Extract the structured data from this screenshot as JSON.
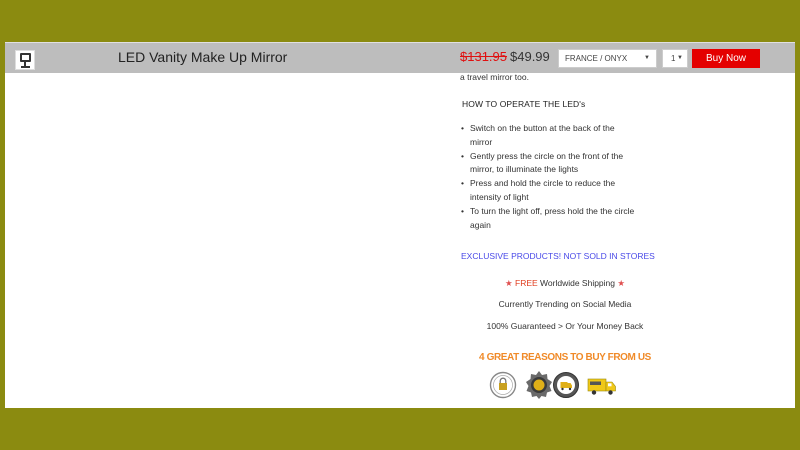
{
  "header": {
    "product_title": "LED Vanity Make Up Mirror",
    "price_old": "$131.95",
    "price_new": "$49.99",
    "variant_select": "FRANCE / ONYX",
    "quantity_select": "1",
    "buy_button": "Buy Now"
  },
  "description": {
    "travel_line": "a travel mirror too.",
    "howto_heading": "HOW TO OPERATE THE LED's",
    "bullets": [
      {
        "line1": "Switch on the button at the back of the",
        "line2": "mirror"
      },
      {
        "line1": "Gently press the circle on the front of the",
        "line2": "mirror, to illuminate the lights"
      },
      {
        "line1": "Press and hold the circle to reduce the",
        "line2": "intensity of light"
      },
      {
        "line1": "To turn the light off, press hold the the circle",
        "line2": "again"
      }
    ],
    "exclusive": "EXCLUSIVE PRODUCTS! NOT SOLD IN STORES",
    "shipping_star": "★",
    "shipping_free": "FREE",
    "shipping_rest": " Worldwide Shipping ",
    "trending": "Currently Trending on Social Media",
    "guarantee": "100% Guaranteed > Or Your Money Back"
  },
  "trust": {
    "heading": "4 GREAT REASONS TO BUY FROM US",
    "badges": [
      "secure-checkout-badge-icon",
      "100-percent-guarantee-badge-icon",
      "worldwide-shipping-badge-icon",
      "free-delivery-truck-icon"
    ]
  },
  "colors": {
    "outer_background": "#8b8b10",
    "header_bar": "#bdbdbd",
    "buy_button": "#e40000",
    "old_price": "#e01010",
    "exclusive_text": "#4a4ae8",
    "reasons_heading": "#f08a28"
  }
}
